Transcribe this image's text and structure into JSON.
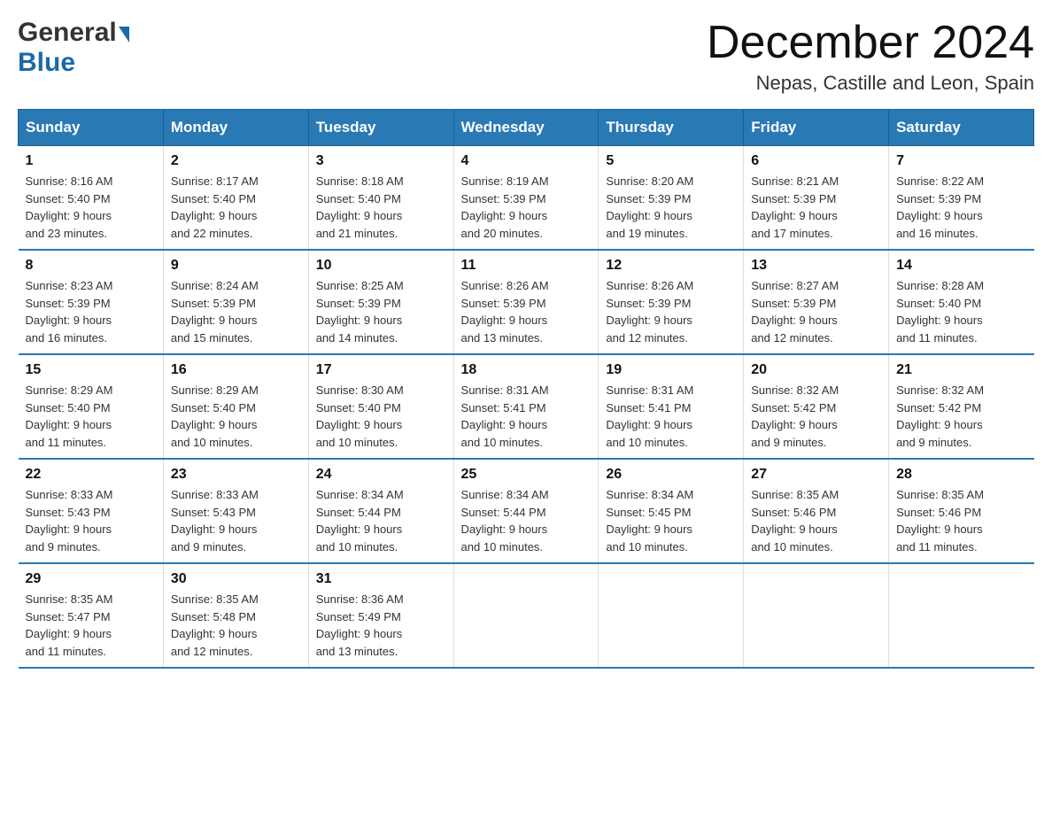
{
  "header": {
    "month_year": "December 2024",
    "location": "Nepas, Castille and Leon, Spain",
    "logo_general": "General",
    "logo_blue": "Blue"
  },
  "weekdays": [
    "Sunday",
    "Monday",
    "Tuesday",
    "Wednesday",
    "Thursday",
    "Friday",
    "Saturday"
  ],
  "weeks": [
    [
      {
        "day": "1",
        "sunrise": "8:16 AM",
        "sunset": "5:40 PM",
        "daylight": "9 hours and 23 minutes."
      },
      {
        "day": "2",
        "sunrise": "8:17 AM",
        "sunset": "5:40 PM",
        "daylight": "9 hours and 22 minutes."
      },
      {
        "day": "3",
        "sunrise": "8:18 AM",
        "sunset": "5:40 PM",
        "daylight": "9 hours and 21 minutes."
      },
      {
        "day": "4",
        "sunrise": "8:19 AM",
        "sunset": "5:39 PM",
        "daylight": "9 hours and 20 minutes."
      },
      {
        "day": "5",
        "sunrise": "8:20 AM",
        "sunset": "5:39 PM",
        "daylight": "9 hours and 19 minutes."
      },
      {
        "day": "6",
        "sunrise": "8:21 AM",
        "sunset": "5:39 PM",
        "daylight": "9 hours and 17 minutes."
      },
      {
        "day": "7",
        "sunrise": "8:22 AM",
        "sunset": "5:39 PM",
        "daylight": "9 hours and 16 minutes."
      }
    ],
    [
      {
        "day": "8",
        "sunrise": "8:23 AM",
        "sunset": "5:39 PM",
        "daylight": "9 hours and 16 minutes."
      },
      {
        "day": "9",
        "sunrise": "8:24 AM",
        "sunset": "5:39 PM",
        "daylight": "9 hours and 15 minutes."
      },
      {
        "day": "10",
        "sunrise": "8:25 AM",
        "sunset": "5:39 PM",
        "daylight": "9 hours and 14 minutes."
      },
      {
        "day": "11",
        "sunrise": "8:26 AM",
        "sunset": "5:39 PM",
        "daylight": "9 hours and 13 minutes."
      },
      {
        "day": "12",
        "sunrise": "8:26 AM",
        "sunset": "5:39 PM",
        "daylight": "9 hours and 12 minutes."
      },
      {
        "day": "13",
        "sunrise": "8:27 AM",
        "sunset": "5:39 PM",
        "daylight": "9 hours and 12 minutes."
      },
      {
        "day": "14",
        "sunrise": "8:28 AM",
        "sunset": "5:40 PM",
        "daylight": "9 hours and 11 minutes."
      }
    ],
    [
      {
        "day": "15",
        "sunrise": "8:29 AM",
        "sunset": "5:40 PM",
        "daylight": "9 hours and 11 minutes."
      },
      {
        "day": "16",
        "sunrise": "8:29 AM",
        "sunset": "5:40 PM",
        "daylight": "9 hours and 10 minutes."
      },
      {
        "day": "17",
        "sunrise": "8:30 AM",
        "sunset": "5:40 PM",
        "daylight": "9 hours and 10 minutes."
      },
      {
        "day": "18",
        "sunrise": "8:31 AM",
        "sunset": "5:41 PM",
        "daylight": "9 hours and 10 minutes."
      },
      {
        "day": "19",
        "sunrise": "8:31 AM",
        "sunset": "5:41 PM",
        "daylight": "9 hours and 10 minutes."
      },
      {
        "day": "20",
        "sunrise": "8:32 AM",
        "sunset": "5:42 PM",
        "daylight": "9 hours and 9 minutes."
      },
      {
        "day": "21",
        "sunrise": "8:32 AM",
        "sunset": "5:42 PM",
        "daylight": "9 hours and 9 minutes."
      }
    ],
    [
      {
        "day": "22",
        "sunrise": "8:33 AM",
        "sunset": "5:43 PM",
        "daylight": "9 hours and 9 minutes."
      },
      {
        "day": "23",
        "sunrise": "8:33 AM",
        "sunset": "5:43 PM",
        "daylight": "9 hours and 9 minutes."
      },
      {
        "day": "24",
        "sunrise": "8:34 AM",
        "sunset": "5:44 PM",
        "daylight": "9 hours and 10 minutes."
      },
      {
        "day": "25",
        "sunrise": "8:34 AM",
        "sunset": "5:44 PM",
        "daylight": "9 hours and 10 minutes."
      },
      {
        "day": "26",
        "sunrise": "8:34 AM",
        "sunset": "5:45 PM",
        "daylight": "9 hours and 10 minutes."
      },
      {
        "day": "27",
        "sunrise": "8:35 AM",
        "sunset": "5:46 PM",
        "daylight": "9 hours and 10 minutes."
      },
      {
        "day": "28",
        "sunrise": "8:35 AM",
        "sunset": "5:46 PM",
        "daylight": "9 hours and 11 minutes."
      }
    ],
    [
      {
        "day": "29",
        "sunrise": "8:35 AM",
        "sunset": "5:47 PM",
        "daylight": "9 hours and 11 minutes."
      },
      {
        "day": "30",
        "sunrise": "8:35 AM",
        "sunset": "5:48 PM",
        "daylight": "9 hours and 12 minutes."
      },
      {
        "day": "31",
        "sunrise": "8:36 AM",
        "sunset": "5:49 PM",
        "daylight": "9 hours and 13 minutes."
      },
      null,
      null,
      null,
      null
    ]
  ],
  "labels": {
    "sunrise": "Sunrise:",
    "sunset": "Sunset:",
    "daylight": "Daylight:"
  }
}
